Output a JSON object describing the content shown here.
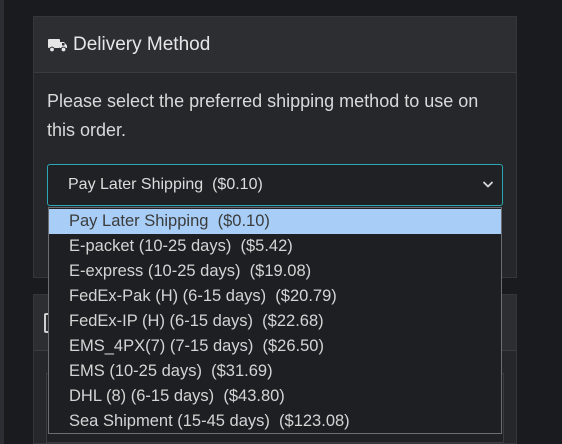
{
  "header": {
    "title": "Delivery Method"
  },
  "instructions": "Please select the preferred shipping method to use on this order.",
  "select": {
    "value": "Pay Later Shipping  ($0.10)"
  },
  "dropdown": {
    "options": [
      "Pay Later Shipping  ($0.10)",
      "E-packet (10-25 days)  ($5.42)",
      "E-express (10-25 days)  ($19.08)",
      "FedEx-Pak (H) (6-15 days)  ($20.79)",
      "FedEx-IP (H) (6-15 days)  ($22.68)",
      "EMS_4PX(7) (7-15 days)  ($26.50)",
      "EMS (10-25 days)  ($31.69)",
      "DHL (8) (6-15 days)  ($43.80)",
      "Sea Shipment (15-45 days)  ($123.08)"
    ]
  },
  "colors": {
    "accent_border": "#2ea7b5",
    "selected_bg": "#a8cef7",
    "page_bg": "#1a1b1e"
  },
  "icons": {
    "header": "truck-icon",
    "select": "chevron-down-icon"
  }
}
